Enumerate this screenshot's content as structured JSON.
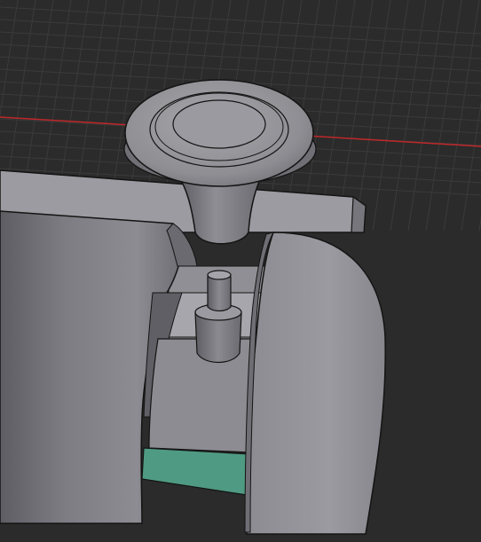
{
  "viewport": {
    "background": "#2b2b2b",
    "grid_color": "#3b3b3b",
    "axis_x_color": "#c0282a"
  },
  "model": {
    "body_color": "#7f7f84",
    "face_light": "#a2a2a8",
    "face_dark": "#6a6a70",
    "outline": "#141414",
    "accent_color": "#4f9a82",
    "knob_color": "#8d8d92"
  }
}
